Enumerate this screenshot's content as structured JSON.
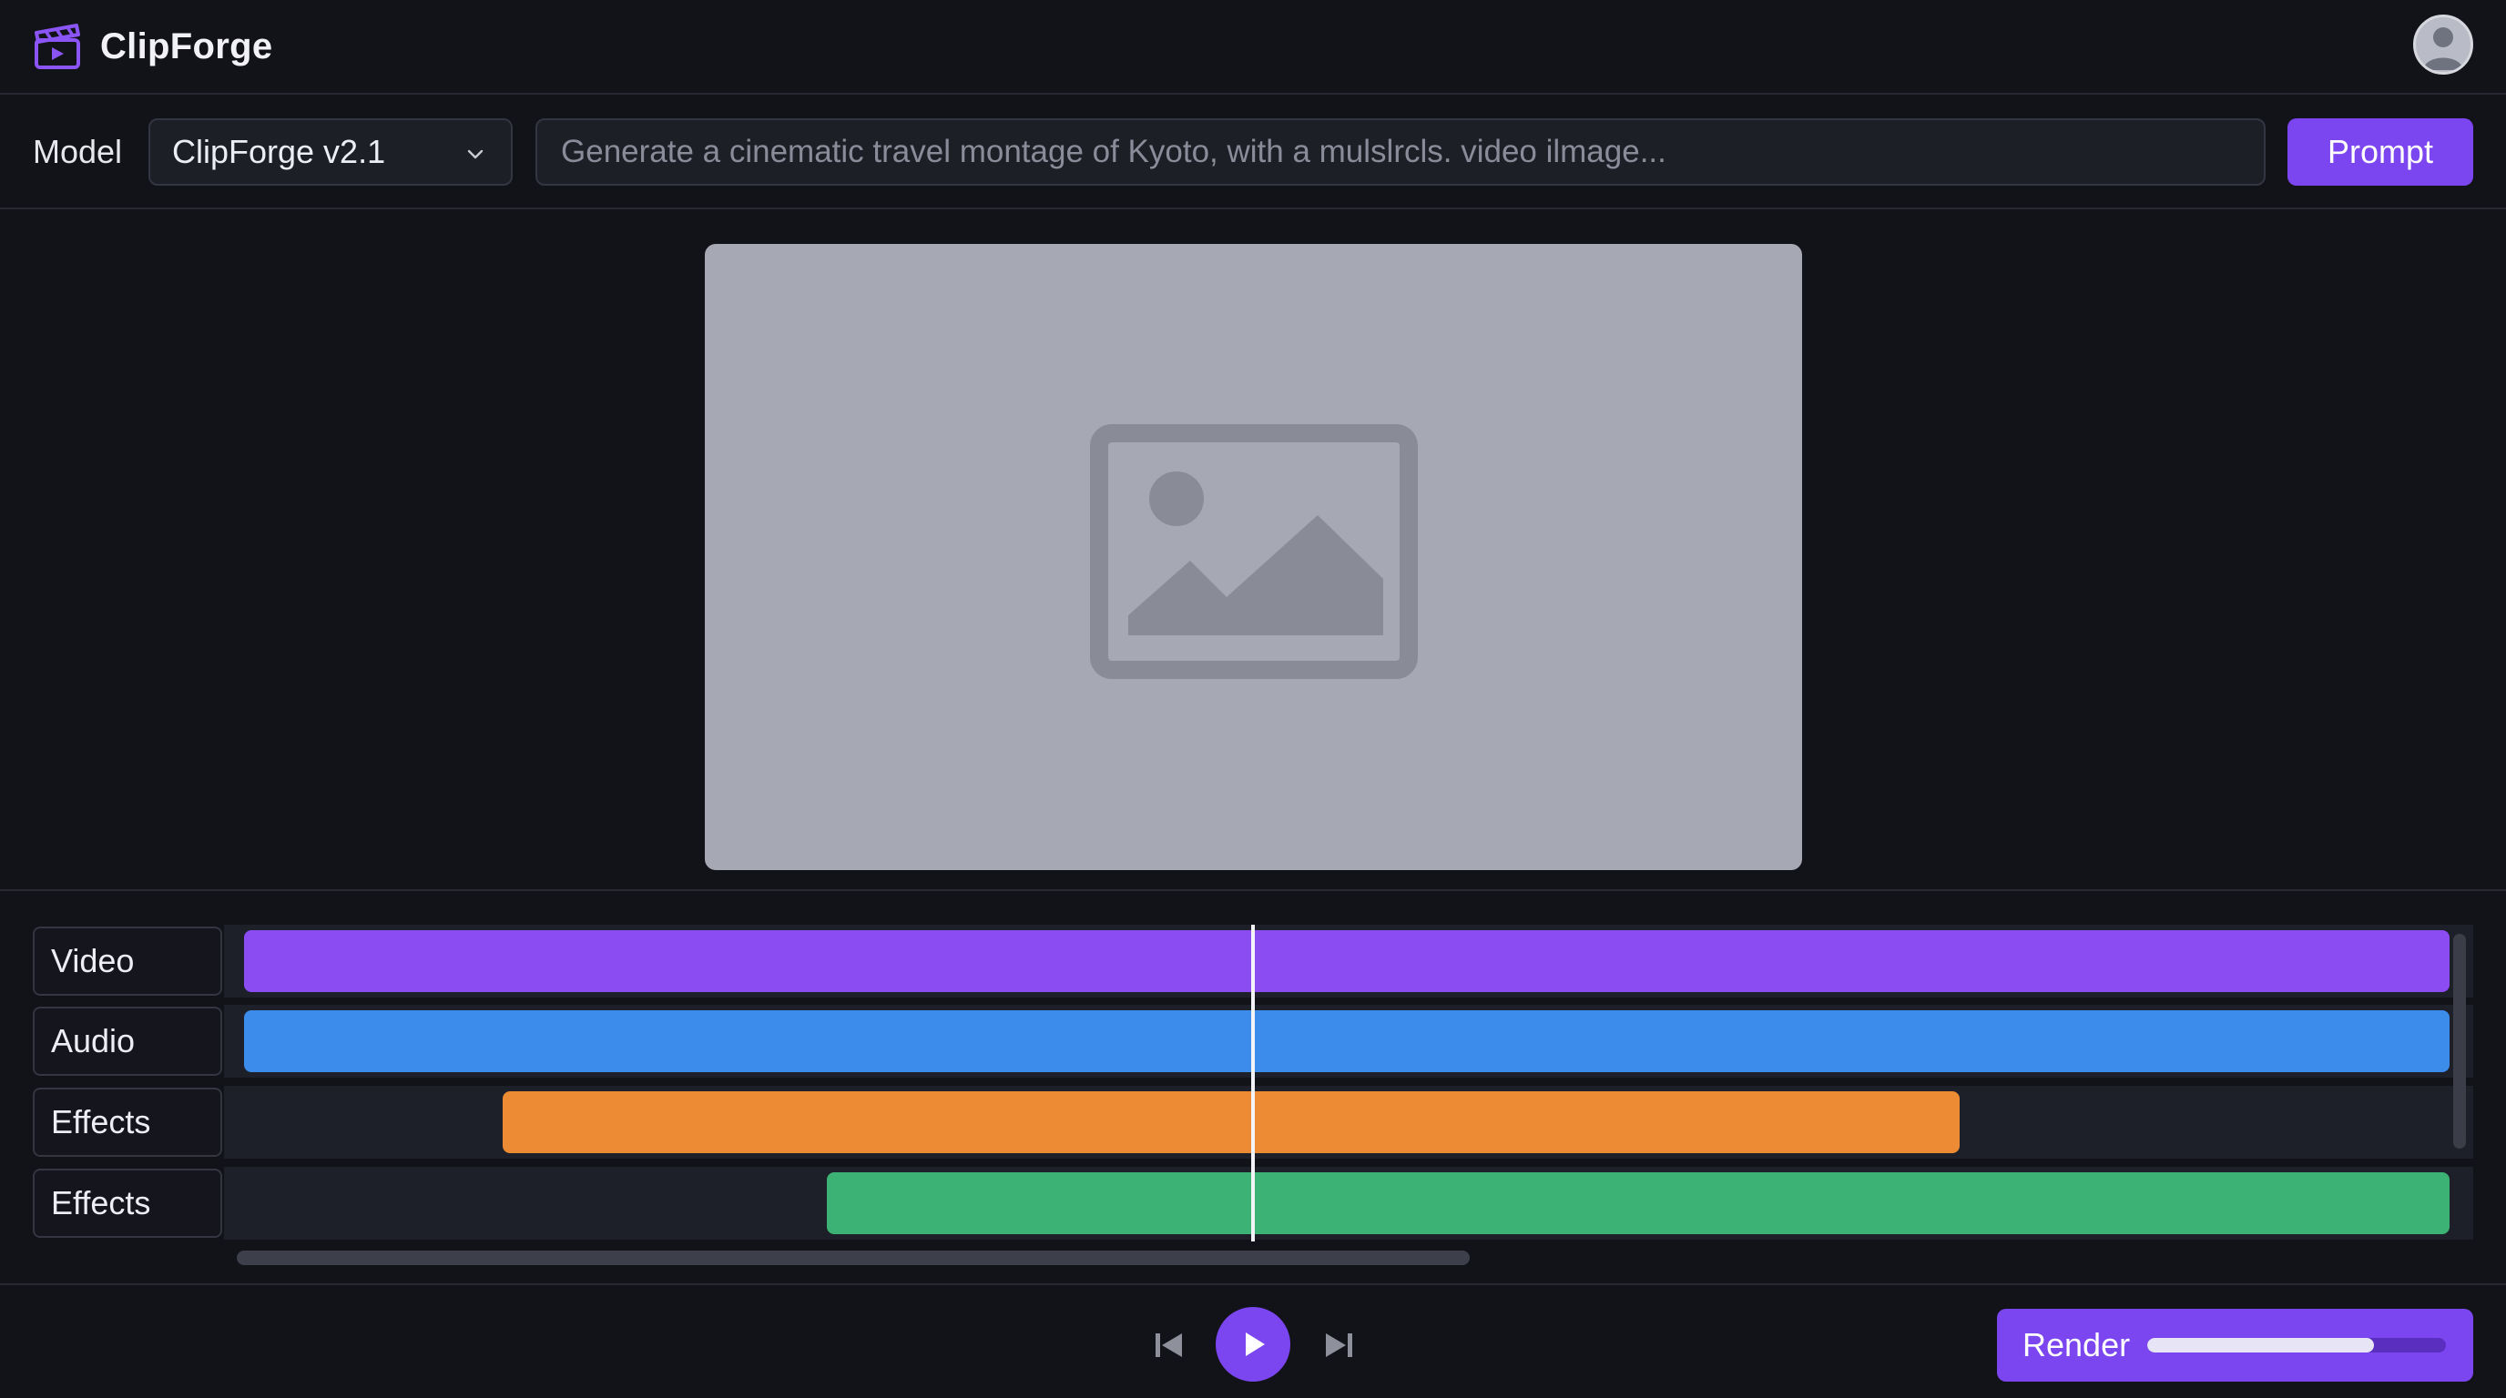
{
  "app": {
    "name": "ClipForge"
  },
  "toolbar": {
    "model_label": "Model",
    "model_value": "ClipForge v2.1",
    "prompt_placeholder": "Generate a cinematic travel montage of Kyoto, with a mulslrcls. video ilmage...",
    "prompt_button": "Prompt"
  },
  "icons": {
    "logo": "clapperboard-icon",
    "avatar": "user-avatar-icon",
    "select": "chevron-down-icon",
    "preview": "image-placeholder-icon",
    "skip_back": "skip-back-icon",
    "play": "play-icon",
    "skip_forward": "skip-forward-icon"
  },
  "timeline": {
    "tracks": [
      {
        "label": "Video",
        "color": "#8b4cf2"
      },
      {
        "label": "Audio",
        "color": "#3b8ceb"
      },
      {
        "label": "Effects",
        "color": "#ec8b33"
      },
      {
        "label": "Effects",
        "color": "#3db275"
      }
    ]
  },
  "render": {
    "label": "Render",
    "progress": 0.76
  },
  "colors": {
    "accent": "#7b45f0",
    "background": "#121319",
    "preview": "#a6a9b3"
  }
}
